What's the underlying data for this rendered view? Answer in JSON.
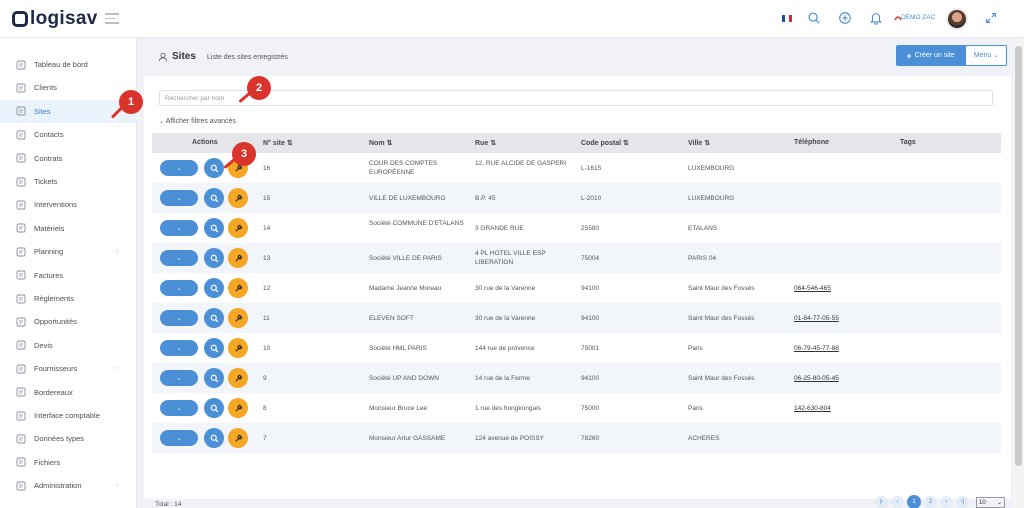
{
  "brand": {
    "name": "logisav"
  },
  "topbar": {
    "user": "DEMO ZAC",
    "flag_colors": [
      "#1f4fa3",
      "#ffffff",
      "#d7263d"
    ]
  },
  "sidebar": {
    "items": [
      {
        "label": "Tableau de bord",
        "icon": "dashboard-icon"
      },
      {
        "label": "Clients",
        "icon": "clients-icon"
      },
      {
        "label": "Sites",
        "icon": "sites-icon",
        "active": true
      },
      {
        "label": "Contacts",
        "icon": "contacts-icon"
      },
      {
        "label": "Contrats",
        "icon": "contracts-icon"
      },
      {
        "label": "Tickets",
        "icon": "tickets-icon"
      },
      {
        "label": "Interventions",
        "icon": "wrench-icon"
      },
      {
        "label": "Matériels",
        "icon": "equipment-icon"
      },
      {
        "label": "Planning",
        "icon": "calendar-icon",
        "chevron": true
      },
      {
        "label": "Factures",
        "icon": "invoice-icon"
      },
      {
        "label": "Règlements",
        "icon": "payments-icon"
      },
      {
        "label": "Opportunités",
        "icon": "opportunities-icon"
      },
      {
        "label": "Devis",
        "icon": "quote-icon"
      },
      {
        "label": "Fournisseurs",
        "icon": "truck-icon",
        "chevron": true
      },
      {
        "label": "Bordereaux",
        "icon": "slips-icon"
      },
      {
        "label": "Interface comptable",
        "icon": "export-icon"
      },
      {
        "label": "Données types",
        "icon": "data-types-icon"
      },
      {
        "label": "Fichiers",
        "icon": "files-icon"
      },
      {
        "label": "Administration",
        "icon": "admin-icon",
        "chevron": true
      }
    ]
  },
  "header": {
    "title": "Sites",
    "subtitle": "Liste des sites enregistrés",
    "create_label": "Créer un site",
    "menu_label": "Menu"
  },
  "search": {
    "placeholder": "Rechercher par nom"
  },
  "filters": {
    "advanced_label": "Afficher filtres avancés"
  },
  "table": {
    "headers": {
      "actions": "Actions",
      "num": "N° site",
      "nom": "Nom",
      "rue": "Rue",
      "cp": "Code postal",
      "ville": "Ville",
      "tel": "Téléphone",
      "tags": "Tags"
    },
    "rows": [
      {
        "num": "16",
        "nom": "COUR DES COMPTES EUROPÉENNE",
        "rue": "12, RUE ALCIDE DE GASPERI",
        "cp": "L-1615",
        "ville": "LUXEMBOURG",
        "tel": ""
      },
      {
        "num": "15",
        "nom": "VILLE DE LUXEMBOURG",
        "rue": "B.P. 45",
        "cp": "L-2010",
        "ville": "LUXEMBOURG",
        "tel": ""
      },
      {
        "num": "14",
        "nom": "Société COMMUNE D'ETALANS",
        "rue": "3 GRANDE RUE",
        "cp": "25580",
        "ville": "ETALANS",
        "tel": ""
      },
      {
        "num": "13",
        "nom": "Société VILLE DE PARIS",
        "rue": "4 PL HOTEL VILLE ESP LIBERATION",
        "cp": "75004",
        "ville": "PARIS 04",
        "tel": ""
      },
      {
        "num": "12",
        "nom": "Madame Jeanne Moreau",
        "rue": "30 rue de la Varenne",
        "cp": "94100",
        "ville": "Saint Maur des Fossés",
        "tel": "064-546-465"
      },
      {
        "num": "11",
        "nom": "ELEVEN SOFT",
        "rue": "30 rue de la Varenne",
        "cp": "94100",
        "ville": "Saint Maur des Fossés",
        "tel": "01-84-77-05-55"
      },
      {
        "num": "10",
        "nom": "Société HML PARIS",
        "rue": "144 rue de provence",
        "cp": "75001",
        "ville": "Paris",
        "tel": "06-79-45-77-88"
      },
      {
        "num": "9",
        "nom": "Société UP AND DOWN",
        "rue": "14 rue de la Ferme",
        "cp": "94100",
        "ville": "Saint Maur des Fossés",
        "tel": "06-25-80-05-45"
      },
      {
        "num": "8",
        "nom": "Monsieur Bruce Lee",
        "rue": "1 rue des hongkongais",
        "cp": "75000",
        "ville": "Paris",
        "tel": "142-630-804"
      },
      {
        "num": "7",
        "nom": "Monsieur Artur GASSAME",
        "rue": "124 avenue de POISSY",
        "cp": "78260",
        "ville": "ACHERES",
        "tel": ""
      }
    ]
  },
  "footer": {
    "total": "Total : 14",
    "pages": [
      "1",
      "2"
    ],
    "current_page": "1",
    "page_size": "10"
  },
  "markers": [
    "1",
    "2",
    "3"
  ],
  "colors": {
    "accent": "#4b8fd6",
    "edit": "#f5a623",
    "marker": "#d9342b"
  }
}
